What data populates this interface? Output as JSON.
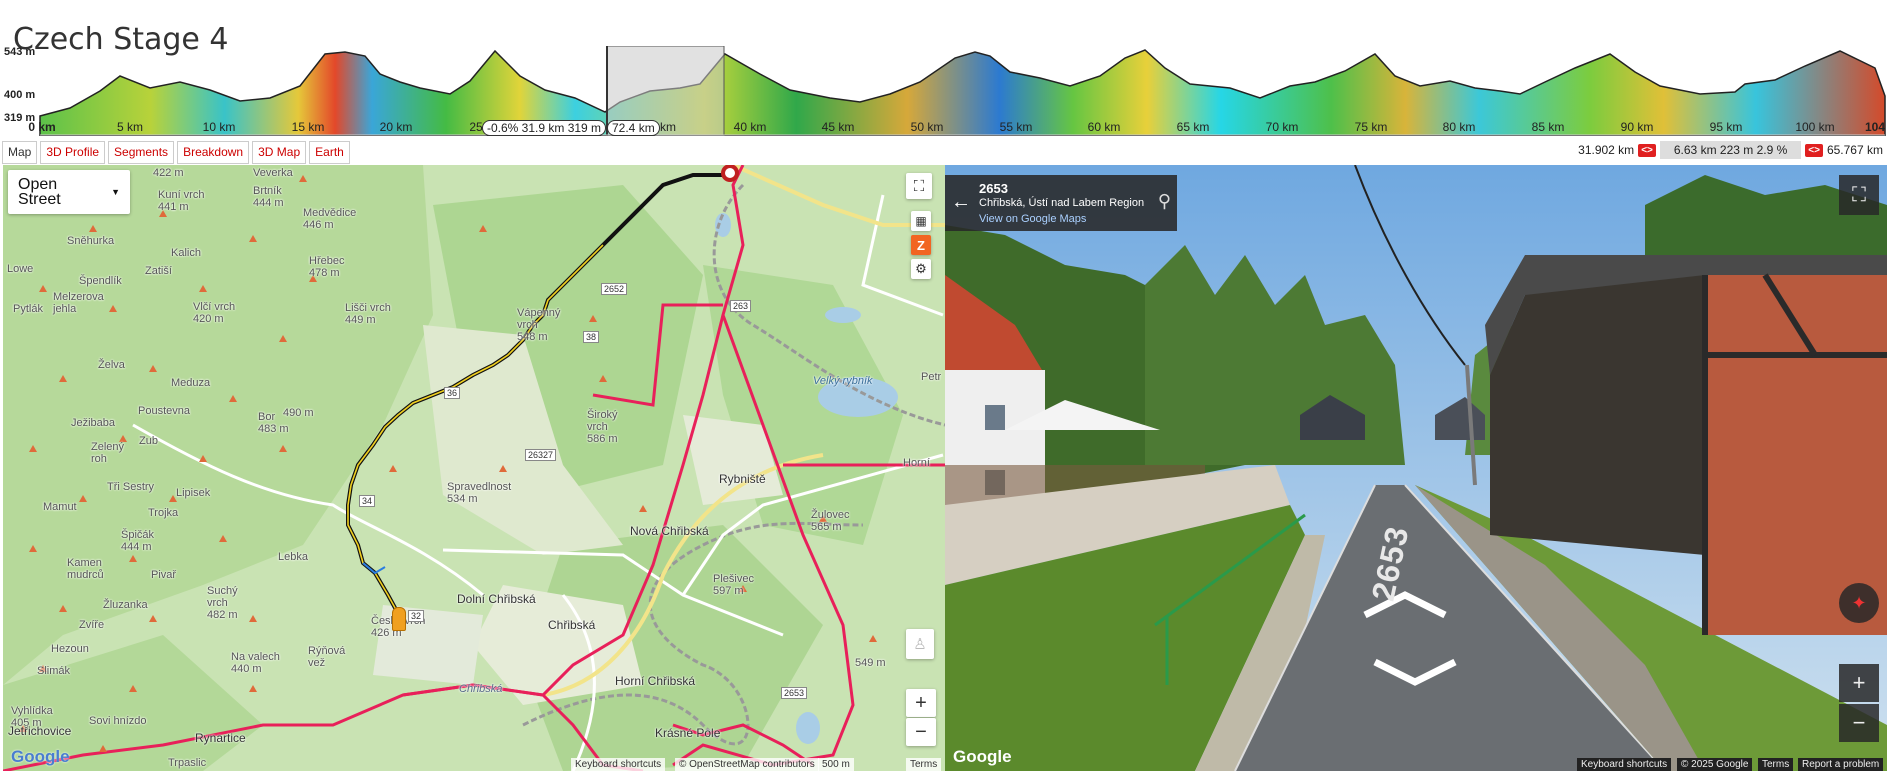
{
  "page": {
    "title": "Czech Stage 4"
  },
  "profile": {
    "y_labels": [
      "543 m",
      "400 m",
      "319 m"
    ],
    "x_labels": [
      "0 km",
      "5 km",
      "10 km",
      "15 km",
      "20 km",
      "25",
      "km",
      "40 km",
      "45 km",
      "50 km",
      "55 km",
      "60 km",
      "65 km",
      "70 km",
      "75 km",
      "80 km",
      "85 km",
      "90 km",
      "95 km",
      "100 km",
      "104"
    ],
    "pill_left": "-0.6% 31.9 km 319 m",
    "pill_right": "72.4 km"
  },
  "tabs": [
    {
      "label": "Map",
      "active": true
    },
    {
      "label": "3D Profile"
    },
    {
      "label": "Segments"
    },
    {
      "label": "Breakdown"
    },
    {
      "label": "3D Map"
    },
    {
      "label": "Earth"
    }
  ],
  "segment": {
    "start": "31.902 km",
    "prev": "<>",
    "info": "6.63 km 223 m 2.9 %",
    "next": "<>",
    "end": "65.767 km"
  },
  "map": {
    "layer_select": "Open Street",
    "zoom_in": "+",
    "zoom_out": "−",
    "attr_shortcuts": "Keyboard shortcuts",
    "attr_osm": "© OpenStreetMap contributors",
    "attr_scale": "500 m",
    "attr_terms": "Terms",
    "google": "Google",
    "road_labels": [
      "2652",
      "38",
      "36",
      "34",
      "32",
      "26327",
      "263",
      "2653"
    ],
    "labels": [
      "422 m",
      "Veverka",
      "Brtník\n444 m",
      "Kuní vrch\n441 m",
      "Medvědice\n446 m",
      "Sněhurka",
      "Kalich",
      "Hřebec\n478 m",
      "Zatiší",
      "Špendlík",
      "Lowe",
      "Melzerova\njehla",
      "Pytlák",
      "Vlčí vrch\n420 m",
      "Lišči vrch\n449 m",
      "Vápenný\nvrch\n548 m",
      "Velký rybník",
      "Petr",
      "Želva",
      "Meduza",
      "Poustevna",
      "Ježibaba",
      "Bor\n483 m",
      "490 m",
      "Široký\nvrch\n586 m",
      "Zub",
      "Zelený\nroh",
      "Tři Sestry",
      "Lipisek",
      "Mamut",
      "Trojka",
      "Spravedlnost\n534 m",
      "Rybniště",
      "Horní",
      "Nová Chřibská",
      "Žulovec\n565 m",
      "Lebka",
      "Špičák\n444 m",
      "Pivař",
      "Kamen\nmudrců",
      "Suchý\nvrch\n482 m",
      "Plešivec\n597 m",
      "Žluzanka",
      "Dolní Chřibská",
      "Chřibská",
      "Český vrch\n426 m",
      "Hezoun",
      "Zvíře",
      "Slimák",
      "Na valech\n440 m",
      "Rýňová\nvež",
      "Chřibská",
      "Horní Chřibská",
      "Vyhlídka\n405 m",
      "Jetřichovice",
      "Sovi hnízdo",
      "Rynartice",
      "Krásné Pole",
      "Trpaslic",
      "549 m"
    ]
  },
  "streetview": {
    "road": "2653",
    "place": "Chřibská, Ústí nad Labem Region",
    "link": "View on Google Maps",
    "road_marking": "2653",
    "google": "Google",
    "attr_shortcuts": "Keyboard shortcuts",
    "attr_copy": "© 2025 Google",
    "attr_terms": "Terms",
    "attr_report": "Report a problem",
    "zoom_in": "+",
    "zoom_out": "−"
  },
  "colors": {
    "accent": "#cc0000",
    "route": "#111111",
    "road_red": "#e8205a",
    "map_bg": "#c9e3b3"
  }
}
